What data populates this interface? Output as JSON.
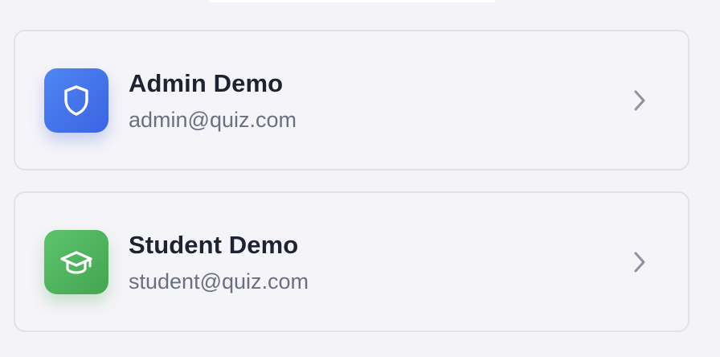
{
  "accounts": [
    {
      "name": "Admin Demo",
      "email": "admin@quiz.com",
      "icon": "shield-icon",
      "color": "#3f6ee8"
    },
    {
      "name": "Student Demo",
      "email": "student@quiz.com",
      "icon": "graduation-cap-icon",
      "color": "#4fb45f"
    }
  ]
}
